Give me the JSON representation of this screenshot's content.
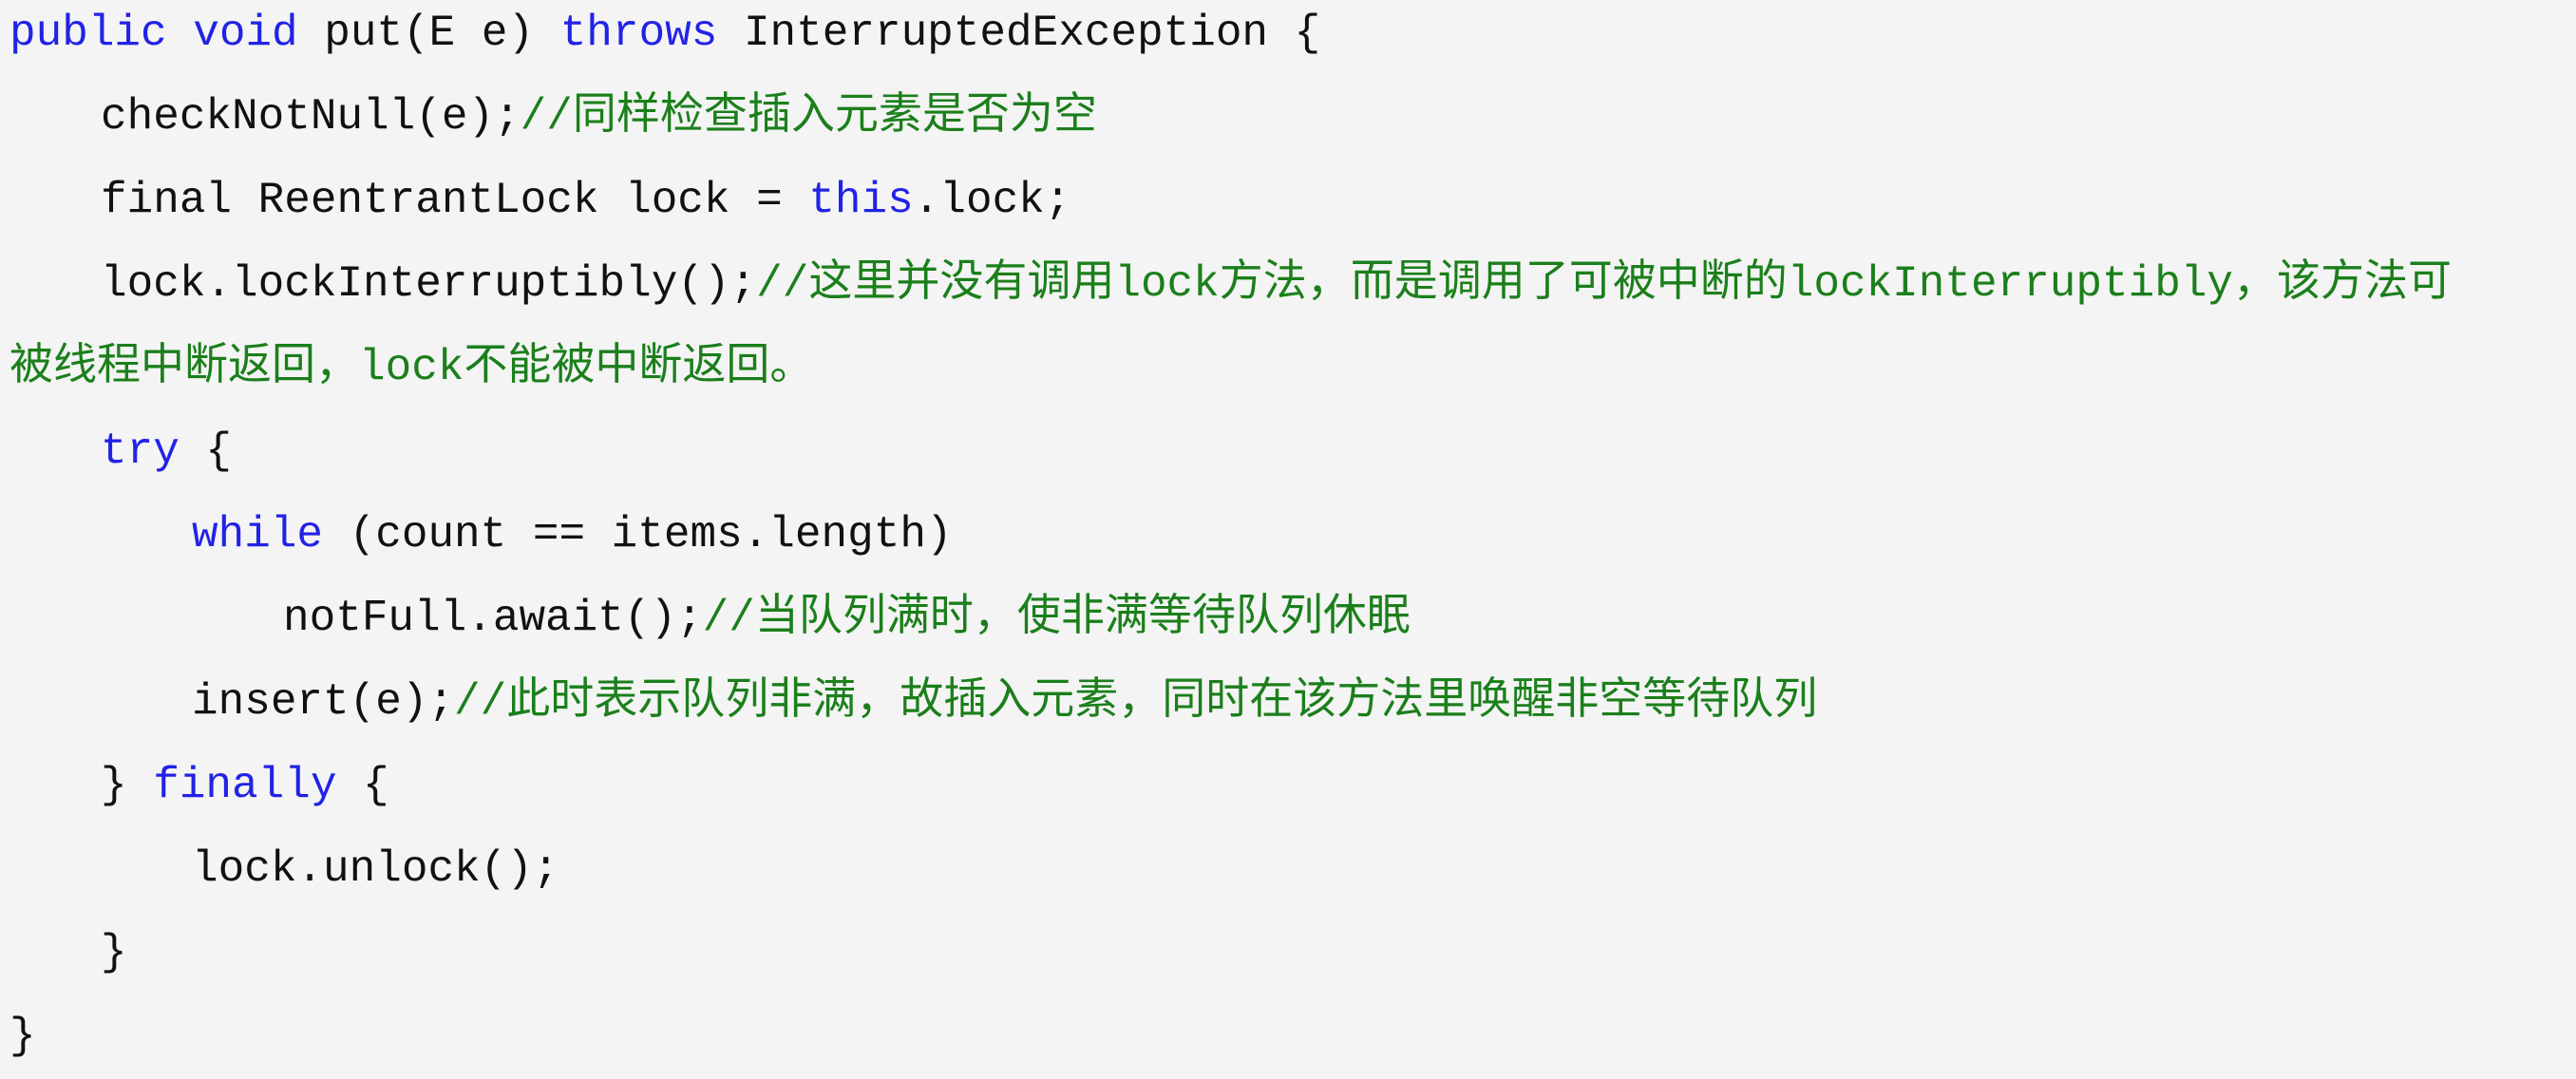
{
  "colors": {
    "background": "#f4f4f4",
    "keyword": "#2222e6",
    "plain": "#111111",
    "comment": "#1b7f1b"
  },
  "code": {
    "language": "java",
    "lines": [
      {
        "indent": 0,
        "segments": [
          {
            "type": "keyword",
            "text": "public void"
          },
          {
            "type": "plain",
            "text": " put(E e) "
          },
          {
            "type": "keyword",
            "text": "throws"
          },
          {
            "type": "plain",
            "text": " InterruptedException {"
          }
        ]
      },
      {
        "indent": 1,
        "segments": [
          {
            "type": "plain",
            "text": "checkNotNull(e);"
          },
          {
            "type": "comment",
            "text": "//同样检查插入元素是否为空"
          }
        ]
      },
      {
        "indent": 1,
        "segments": [
          {
            "type": "plain",
            "text": "final ReentrantLock lock = "
          },
          {
            "type": "keyword",
            "text": "this"
          },
          {
            "type": "plain",
            "text": ".lock;"
          }
        ]
      },
      {
        "indent": 1,
        "segments": [
          {
            "type": "plain",
            "text": "lock.lockInterruptibly();"
          },
          {
            "type": "comment",
            "text": "//这里并没有调用lock方法，而是调用了可被中断的lockInterruptibly，该方法可"
          }
        ]
      },
      {
        "indent": 0,
        "segments": [
          {
            "type": "comment",
            "text": "被线程中断返回，lock不能被中断返回。"
          }
        ]
      },
      {
        "indent": 1,
        "segments": [
          {
            "type": "keyword",
            "text": "try"
          },
          {
            "type": "plain",
            "text": " {"
          }
        ]
      },
      {
        "indent": 2,
        "segments": [
          {
            "type": "keyword",
            "text": "while"
          },
          {
            "type": "plain",
            "text": " (count == items.length)"
          }
        ]
      },
      {
        "indent": 3,
        "segments": [
          {
            "type": "plain",
            "text": "notFull.await();"
          },
          {
            "type": "comment",
            "text": "//当队列满时，使非满等待队列休眠"
          }
        ]
      },
      {
        "indent": 2,
        "segments": [
          {
            "type": "plain",
            "text": "insert(e);"
          },
          {
            "type": "comment",
            "text": "//此时表示队列非满，故插入元素，同时在该方法里唤醒非空等待队列"
          }
        ]
      },
      {
        "indent": 1,
        "segments": [
          {
            "type": "plain",
            "text": "} "
          },
          {
            "type": "keyword",
            "text": "finally"
          },
          {
            "type": "plain",
            "text": " {"
          }
        ]
      },
      {
        "indent": 2,
        "segments": [
          {
            "type": "plain",
            "text": "lock.unlock();"
          }
        ]
      },
      {
        "indent": 1,
        "segments": [
          {
            "type": "plain",
            "text": "}"
          }
        ]
      },
      {
        "indent": 0,
        "segments": [
          {
            "type": "plain",
            "text": "}"
          }
        ]
      }
    ]
  }
}
